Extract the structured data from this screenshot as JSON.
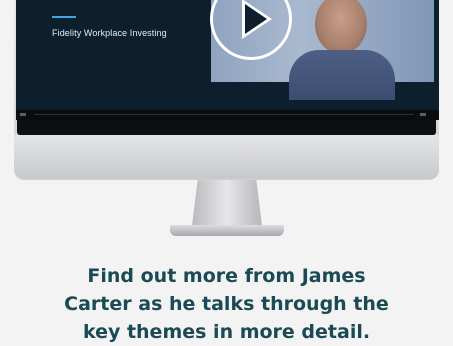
{
  "video": {
    "slide_label": "Fidelity Workplace Investing"
  },
  "caption": {
    "line1": "Find out more from James",
    "line2": "Carter as he talks through the",
    "line3": "key themes in more detail."
  },
  "icons": {
    "play": "play-icon"
  },
  "colors": {
    "caption_text": "#1a4a53",
    "accent_line": "#39a9e0",
    "screen_background": "#0d1f2d"
  }
}
